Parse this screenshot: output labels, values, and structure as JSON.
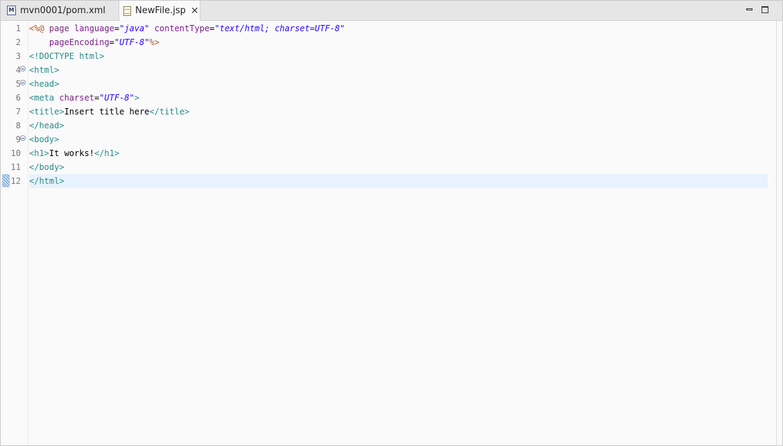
{
  "tabs": [
    {
      "label": "mvn0001/pom.xml",
      "icon": "maven-pom-icon",
      "active": false
    },
    {
      "label": "NewFile.jsp",
      "icon": "jsp-file-icon",
      "active": true,
      "closable": true
    }
  ],
  "window_controls": {
    "minimize": "minimize-icon",
    "maximize": "maximize-icon"
  },
  "editor": {
    "current_line": 12,
    "fold_lines": [
      4,
      5,
      9
    ],
    "lines": [
      {
        "n": "1",
        "tokens": [
          {
            "t": "<%@ ",
            "c": "jsp"
          },
          {
            "t": "page ",
            "c": "dir"
          },
          {
            "t": "language",
            "c": "attr"
          },
          {
            "t": "=",
            "c": "text"
          },
          {
            "t": "\"java\"",
            "c": "val"
          },
          {
            "t": " ",
            "c": "text"
          },
          {
            "t": "contentType",
            "c": "attr"
          },
          {
            "t": "=",
            "c": "text"
          },
          {
            "t": "\"text/html; charset=UTF-8\"",
            "c": "val"
          }
        ]
      },
      {
        "n": "2",
        "tokens": [
          {
            "t": "    ",
            "c": "text"
          },
          {
            "t": "pageEncoding",
            "c": "attr"
          },
          {
            "t": "=",
            "c": "text"
          },
          {
            "t": "\"UTF-8\"",
            "c": "val"
          },
          {
            "t": "%>",
            "c": "jsp"
          }
        ]
      },
      {
        "n": "3",
        "tokens": [
          {
            "t": "<!DOCTYPE html>",
            "c": "doctype"
          }
        ]
      },
      {
        "n": "4",
        "tokens": [
          {
            "t": "<html>",
            "c": "tag"
          }
        ]
      },
      {
        "n": "5",
        "tokens": [
          {
            "t": "<head>",
            "c": "tag"
          }
        ]
      },
      {
        "n": "6",
        "tokens": [
          {
            "t": "<meta ",
            "c": "tag"
          },
          {
            "t": "charset",
            "c": "attr"
          },
          {
            "t": "=",
            "c": "text"
          },
          {
            "t": "\"UTF-8\"",
            "c": "val"
          },
          {
            "t": ">",
            "c": "tag"
          }
        ]
      },
      {
        "n": "7",
        "tokens": [
          {
            "t": "<title>",
            "c": "tag"
          },
          {
            "t": "Insert title here",
            "c": "text"
          },
          {
            "t": "</title>",
            "c": "tag"
          }
        ]
      },
      {
        "n": "8",
        "tokens": [
          {
            "t": "</head>",
            "c": "tag"
          }
        ]
      },
      {
        "n": "9",
        "tokens": [
          {
            "t": "<body>",
            "c": "tag"
          }
        ]
      },
      {
        "n": "10",
        "tokens": [
          {
            "t": "<h1>",
            "c": "tag"
          },
          {
            "t": "It works!",
            "c": "text"
          },
          {
            "t": "</h1>",
            "c": "tag"
          }
        ]
      },
      {
        "n": "11",
        "tokens": [
          {
            "t": "</body>",
            "c": "tag"
          }
        ]
      },
      {
        "n": "12",
        "tokens": [
          {
            "t": "</html>",
            "c": "tag"
          }
        ]
      }
    ]
  },
  "colors": {
    "jsp_delimiter": "#b05a2a",
    "directive": "#7a2a7a",
    "attribute": "#7a1e8a",
    "attribute_value": "#2a00ff",
    "tag": "#2a8a8a",
    "current_line_bg": "#e8f2fe"
  }
}
